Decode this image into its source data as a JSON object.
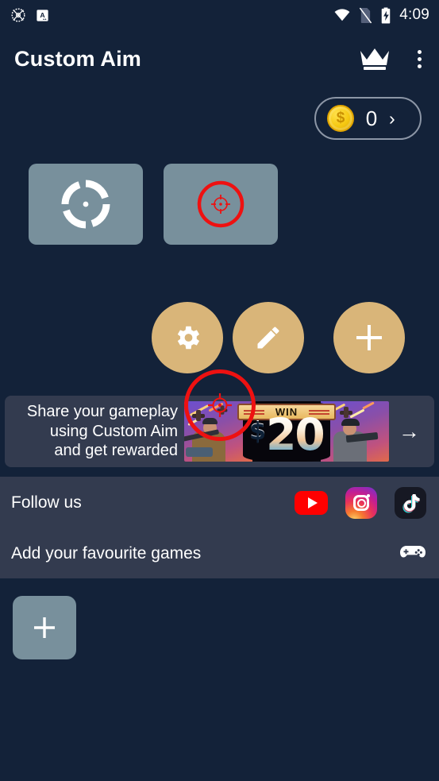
{
  "status_bar": {
    "time": "4:09",
    "left_icons": [
      "aim-crosshair-icon",
      "app-letter-a-icon"
    ],
    "right_icons": [
      "wifi-icon",
      "no-sim-icon",
      "battery-charging-icon"
    ]
  },
  "app_bar": {
    "title": "Custom Aim",
    "premium_icon": "crown-icon",
    "overflow_icon": "more-vertical-icon"
  },
  "coins": {
    "count": "0",
    "coin_symbol": "$",
    "chevron": "›",
    "coin_color": "#f6c913"
  },
  "crosshair_previews": [
    {
      "name": "crosshair-preview-white",
      "style": "white-ring-crosshair"
    },
    {
      "name": "crosshair-preview-red",
      "style": "red-circle-crosshair"
    }
  ],
  "action_buttons": [
    {
      "name": "settings-button",
      "icon": "gear-icon"
    },
    {
      "name": "edit-button",
      "icon": "pencil-icon"
    },
    {
      "name": "add-button",
      "icon": "plus-icon"
    }
  ],
  "overlay": {
    "name": "floating-crosshair-overlay",
    "color": "#ee1111"
  },
  "promo": {
    "text": "Share your gameplay using Custom Aim and get rewarded",
    "line1": "Share your gameplay",
    "line2": "using Custom Aim",
    "line3": "and get rewarded",
    "banner_ribbon": "WIN",
    "banner_currency": "$",
    "banner_amount": "20",
    "arrow": "→"
  },
  "follow": {
    "label": "Follow us",
    "socials": [
      {
        "name": "youtube-icon",
        "label": "YouTube",
        "color": "#ff0000"
      },
      {
        "name": "instagram-icon",
        "label": "Instagram",
        "color": "#e9325a"
      },
      {
        "name": "tiktok-icon",
        "label": "TikTok",
        "color": "#161823"
      }
    ]
  },
  "favourites": {
    "label": "Add your favourite games",
    "icon": "gamepad-icon"
  },
  "tiles": {
    "add_tile_icon": "plus-icon"
  },
  "theme": {
    "background": "#132239",
    "panel": "#333b4f",
    "card": "#78909c",
    "accent_gold": "#d9b579",
    "text": "#ffffff"
  }
}
